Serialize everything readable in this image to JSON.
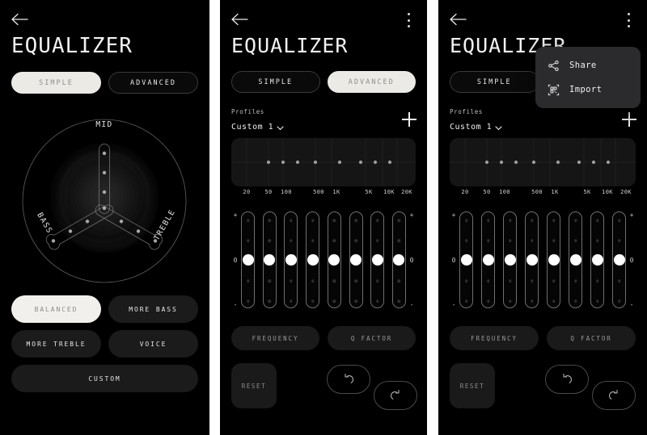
{
  "app": {
    "title": "EQUALIZER",
    "back_icon": "arrow-left-icon",
    "overflow_icon": "more-vertical-icon"
  },
  "modes": {
    "simple": "SIMPLE",
    "advanced": "ADVANCED"
  },
  "simple_view": {
    "radial": {
      "labels": {
        "mid": "MID",
        "bass": "BASS",
        "treble": "TREBLE"
      }
    },
    "presets": [
      {
        "label": "BALANCED",
        "active": true
      },
      {
        "label": "MORE BASS",
        "active": false
      },
      {
        "label": "MORE TREBLE",
        "active": false
      },
      {
        "label": "VOICE",
        "active": false
      },
      {
        "label": "CUSTOM",
        "active": false
      }
    ]
  },
  "advanced_view": {
    "profiles_label": "Profiles",
    "profile_selected": "Custom 1",
    "add_profile_icon": "plus-icon",
    "chevron_icon": "chevron-down-icon",
    "frequency_ticks": [
      "20",
      "50",
      "100",
      "500",
      "1K",
      "5K",
      "10K",
      "20K"
    ],
    "scale": {
      "max": "+",
      "mid": "0",
      "min": "-"
    },
    "band_count": 8,
    "band_values": [
      0,
      0,
      0,
      0,
      0,
      0,
      0,
      0
    ],
    "buttons": {
      "frequency": "FREQUENCY",
      "q_factor": "Q FACTOR",
      "reset": "RESET",
      "undo_icon": "undo-icon",
      "redo_icon": "redo-icon"
    }
  },
  "menu": {
    "items": [
      {
        "label": "Share",
        "icon": "share-icon"
      },
      {
        "label": "Import",
        "icon": "qr-code-icon"
      }
    ]
  },
  "chart_data": {
    "type": "line",
    "title": "Equalizer frequency response",
    "xlabel": "",
    "ylabel": "",
    "x": [
      "20",
      "50",
      "100",
      "500",
      "1K",
      "5K",
      "10K",
      "20K"
    ],
    "categories": [
      "20",
      "50",
      "100",
      "500",
      "1K",
      "5K",
      "10K",
      "20K"
    ],
    "values": [
      0,
      0,
      0,
      0,
      0,
      0,
      0,
      0
    ],
    "ylim": [
      -1,
      1
    ],
    "grid": true,
    "legend": "none"
  }
}
